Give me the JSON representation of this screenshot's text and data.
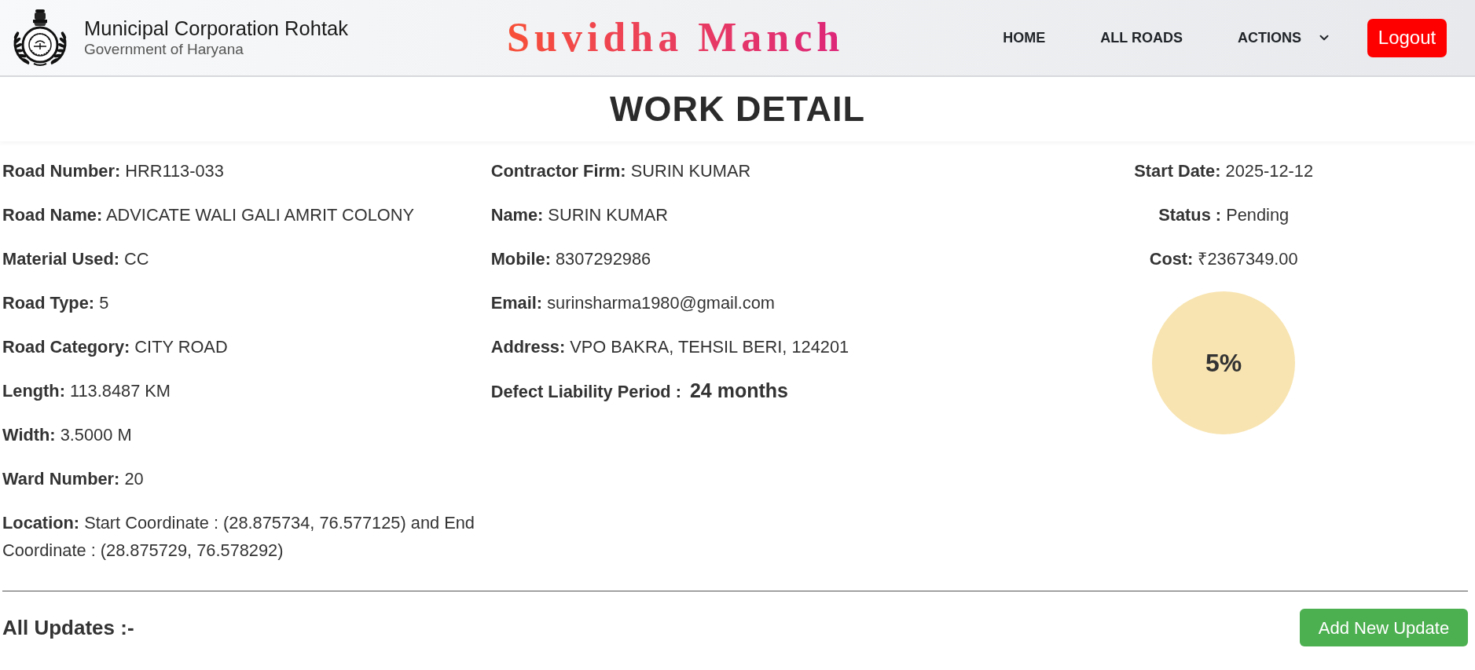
{
  "header": {
    "org_name": "Municipal Corporation Rohtak",
    "org_subtitle": "Government of Haryana",
    "app_title": "Suvidha Manch",
    "nav": [
      {
        "label": "HOME",
        "kind": "link"
      },
      {
        "label": "ALL ROADS",
        "kind": "link"
      },
      {
        "label": "ACTIONS",
        "kind": "dropdown"
      }
    ],
    "logout_button": "Logout"
  },
  "page_title": "WORK DETAIL",
  "road_details": [
    {
      "label": "Road Number:",
      "value": "HRR113-033"
    },
    {
      "label": "Road Name:",
      "value": "ADVICATE WALI GALI AMRIT COLONY"
    },
    {
      "label": "Material Used:",
      "value": "CC"
    },
    {
      "label": "Road Type:",
      "value": "5"
    },
    {
      "label": "Road Category:",
      "value": "CITY ROAD"
    },
    {
      "label": "Length:",
      "value": "113.8487 KM"
    },
    {
      "label": "Width:",
      "value": "3.5000 M"
    },
    {
      "label": "Ward Number:",
      "value": "20"
    },
    {
      "label": "Location:",
      "value": "Start Coordinate : (28.875734, 76.577125) and End Coordinate : (28.875729, 76.578292)"
    }
  ],
  "contractor_details": [
    {
      "label": "Contractor Firm:",
      "value": "SURIN KUMAR"
    },
    {
      "label": "Name:",
      "value": "SURIN KUMAR"
    },
    {
      "label": "Mobile:",
      "value": "8307292986"
    },
    {
      "label": "Email:",
      "value": "surinsharma1980@gmail.com"
    },
    {
      "label": "Address:",
      "value": "VPO BAKRA, TEHSIL BERI, 124201"
    }
  ],
  "defect_liability": {
    "label": "Defect Liability Period :",
    "value": "24 months"
  },
  "work_status": [
    {
      "label": "Start Date:",
      "value": "2025-12-12"
    },
    {
      "label": "Status :",
      "value": "Pending"
    },
    {
      "label": "Cost:",
      "value": "₹2367349.00"
    }
  ],
  "progress": {
    "label": "5%"
  },
  "updates": {
    "title": "All Updates :-",
    "add_button": "Add New Update"
  }
}
